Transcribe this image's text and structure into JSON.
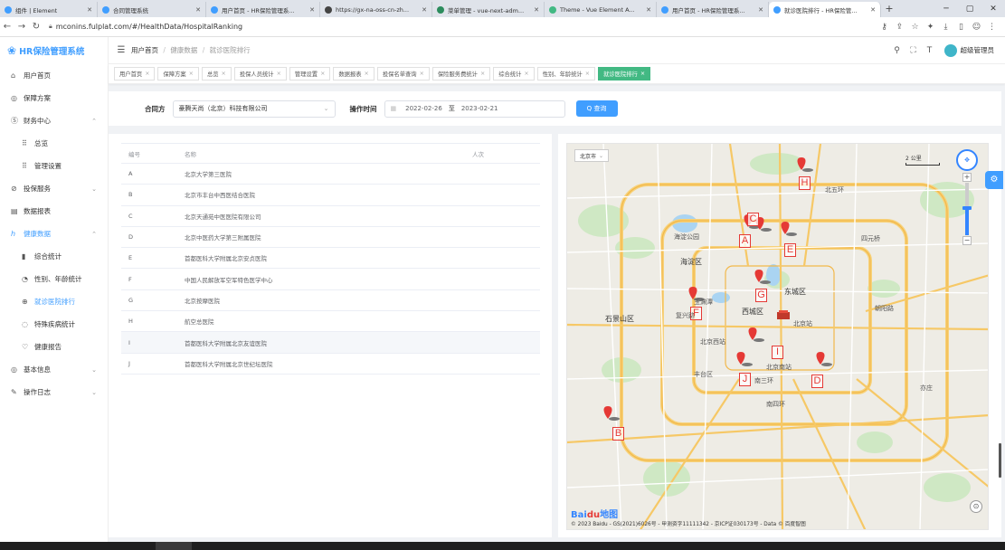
{
  "browser": {
    "tabs": [
      {
        "label": "组件 | Element",
        "color": "#409eff",
        "width": 108
      },
      {
        "label": "合同管理系统",
        "color": "#409eff",
        "width": 120
      },
      {
        "label": "用户首页 - HR保险管理系...",
        "color": "#409eff",
        "width": 126
      },
      {
        "label": "https://gx-na-oss-cn-zh...",
        "color": "#444",
        "width": 124
      },
      {
        "label": "菜单管理 - vue-next-adm...",
        "color": "#2c8c5d",
        "width": 124
      },
      {
        "label": "Theme - Vue Element A...",
        "color": "#42b983",
        "width": 124
      },
      {
        "label": "用户首页 - HR保险管理系...",
        "color": "#409eff",
        "width": 124
      },
      {
        "label": "就诊医院排行 - HR保险管...",
        "color": "#409eff",
        "width": 124,
        "active": true
      }
    ],
    "new_tab": "+",
    "url": "mconins.fulplat.com/#/HealthData/HospitalRanking"
  },
  "app": {
    "title": "HR保险管理系统",
    "user": "超级管理员",
    "breadcrumb": [
      "用户首页",
      "健康数据",
      "就诊医院排行"
    ]
  },
  "sidebar": [
    {
      "name": "nav-home",
      "icon": "⌂",
      "label": "用户首页"
    },
    {
      "name": "nav-plan",
      "icon": "◎",
      "label": "保障方案"
    },
    {
      "name": "nav-finance",
      "icon": "Ⓢ",
      "label": "财务中心",
      "arrow": "⌃"
    },
    {
      "name": "nav-overview",
      "icon": "⠿",
      "label": "总览",
      "sub": true
    },
    {
      "name": "nav-manage",
      "icon": "⠿",
      "label": "管理设置",
      "sub": true
    },
    {
      "name": "nav-insurance",
      "icon": "⊘",
      "label": "投保服务",
      "arrow": "⌄"
    },
    {
      "name": "nav-report",
      "icon": "▤",
      "label": "数据报表"
    },
    {
      "name": "nav-health",
      "icon": "ℎ",
      "label": "健康数据",
      "arrow": "⌃",
      "blue": true
    },
    {
      "name": "nav-comprehensive",
      "icon": "▮",
      "label": "综合统计",
      "sub": true
    },
    {
      "name": "nav-gender-age",
      "icon": "◔",
      "label": "性别、年龄统计",
      "sub": true
    },
    {
      "name": "nav-hospital-ranking",
      "icon": "⊕",
      "label": "就诊医院排行",
      "sub": true,
      "active": true
    },
    {
      "name": "nav-disease",
      "icon": "◌",
      "label": "特殊疾病统计",
      "sub": true
    },
    {
      "name": "nav-health-report",
      "icon": "♡",
      "label": "健康报告",
      "sub": true
    },
    {
      "name": "nav-basic-info",
      "icon": "◎",
      "label": "基本信息",
      "arrow": "⌄"
    },
    {
      "name": "nav-op-log",
      "icon": "✎",
      "label": "操作日志",
      "arrow": "⌄"
    }
  ],
  "tags": [
    {
      "label": "用户首页"
    },
    {
      "label": "保障方案"
    },
    {
      "label": "总览"
    },
    {
      "label": "投保人员统计"
    },
    {
      "label": "管理设置"
    },
    {
      "label": "数据报表"
    },
    {
      "label": "投保名单查询"
    },
    {
      "label": "保险服务费统计"
    },
    {
      "label": "综合统计"
    },
    {
      "label": "性别、年龄统计"
    },
    {
      "label": "就诊医院排行",
      "active": true
    }
  ],
  "filter": {
    "contract_label": "合同方",
    "contract_value": "豪腾天尚（北京）科技有限公司",
    "time_label": "操作时间",
    "start_date": "2022-02-26",
    "range_sep": "至",
    "end_date": "2023-02-21",
    "search_btn": "Q 查询"
  },
  "table": {
    "headers": [
      "编号",
      "名称",
      "人次"
    ],
    "rows": [
      [
        "A",
        "北京大学第三医院",
        ""
      ],
      [
        "B",
        "北京市丰台中西医结合医院",
        ""
      ],
      [
        "C",
        "北京天通苑中医医院有限公司",
        ""
      ],
      [
        "D",
        "北京中医药大学第三附属医院",
        ""
      ],
      [
        "E",
        "首都医科大学附属北京安贞医院",
        ""
      ],
      [
        "F",
        "中国人民解放军空军特色医学中心",
        ""
      ],
      [
        "G",
        "北京按摩医院",
        ""
      ],
      [
        "H",
        "航空总医院",
        ""
      ],
      [
        "I",
        "首都医科大学附属北京友谊医院",
        ""
      ],
      [
        "J",
        "首都医科大学附属北京世纪坛医院",
        ""
      ]
    ],
    "highlight_row": 8
  },
  "map": {
    "city": "北京市",
    "scale": "2 公里",
    "copyright": "© 2023 Baidu - GS(2021)6026号 - 甲测资字11111342 - 京ICP证030173号 - Data © 百度智图",
    "markers": [
      "A",
      "B",
      "C",
      "D",
      "E",
      "F",
      "G",
      "H",
      "I",
      "J"
    ],
    "places": [
      "海淀公园",
      "海淀区",
      "西城区",
      "东城区",
      "朝阳路",
      "丰台区",
      "石景山区",
      "北五环",
      "南四环",
      "南三环",
      "复兴路",
      "玉渊潭",
      "北京西站",
      "北京南站",
      "北京站",
      "四元桥",
      "亦庄"
    ]
  }
}
